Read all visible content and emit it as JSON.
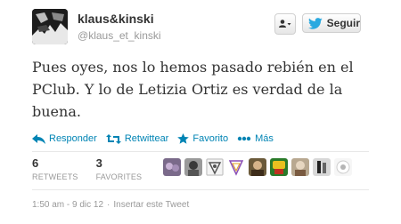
{
  "header": {
    "fullname": "klaus&kinski",
    "username": "klaus_et_kinski",
    "follow_label": "Seguir"
  },
  "tweet": {
    "text": "Pues oyes, nos lo hemos pasado rebién en el PClub. Y lo de Letizia Ortiz es verdad de la buena."
  },
  "actions": {
    "reply": "Responder",
    "retweet": "Retwittear",
    "favorite": "Favorito",
    "more": "Más"
  },
  "stats": {
    "retweets_count": "6",
    "retweets_label": "RETWEETS",
    "favorites_count": "3",
    "favorites_label": "FAVORITES"
  },
  "footer": {
    "timestamp": "1:50 am - 9 dic 12",
    "separator": "·",
    "embed_label": "Insertar este Tweet"
  },
  "colors": {
    "link": "#0084b4",
    "twitter_blue": "#2aa9e0",
    "muted": "#999999"
  }
}
